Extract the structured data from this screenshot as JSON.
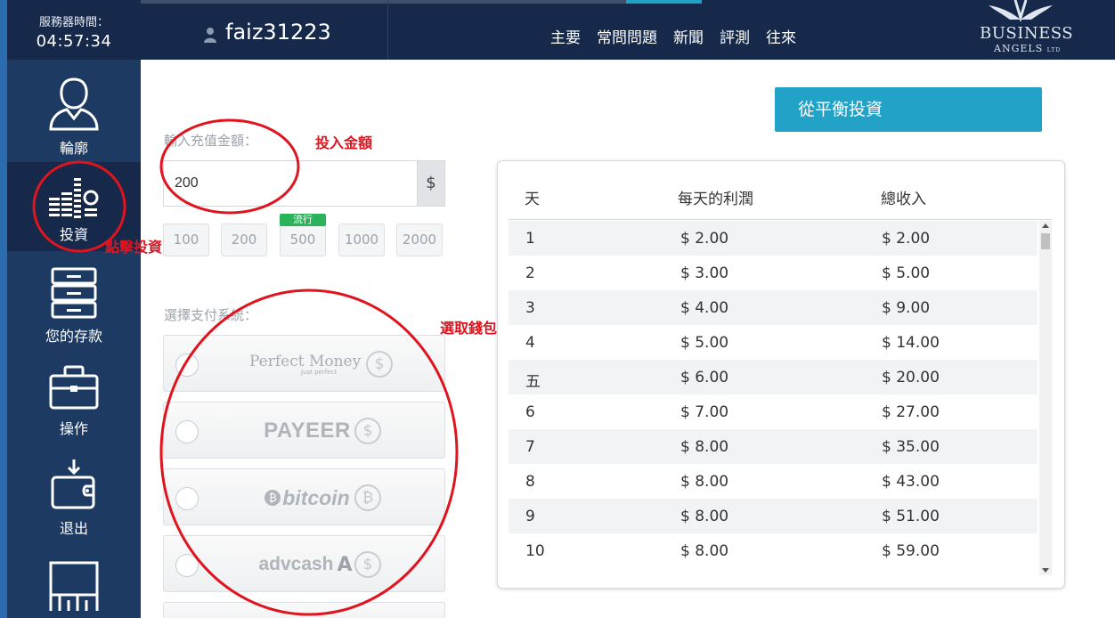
{
  "sidebar": {
    "server_time_label": "服務器時間：",
    "server_time": "04:57:34",
    "items": [
      {
        "label": "輪廓"
      },
      {
        "label": "投資"
      },
      {
        "label": "您的存款"
      },
      {
        "label": "操作"
      },
      {
        "label": "退出"
      }
    ]
  },
  "header": {
    "username": "faiz31223",
    "nav": [
      "主要",
      "常問問題",
      "新聞",
      "評測",
      "往來"
    ],
    "logo_line1": "BUSINESS",
    "logo_line2": "ANGELS",
    "logo_suffix": "LTD"
  },
  "form": {
    "amount_label": "輸入充值金額：",
    "amount_value": "200",
    "currency_symbol": "$",
    "quick_amounts": [
      "100",
      "200",
      "500",
      "1000",
      "2000"
    ],
    "popular_badge": "流行",
    "payment_label": "選擇支付系統：",
    "payment_methods": [
      {
        "name": "Perfect Money",
        "tagline": "Just perfect",
        "coin": "$"
      },
      {
        "name": "PAYEER",
        "coin": "$"
      },
      {
        "name": "bitcoin",
        "coin": "₿"
      },
      {
        "name": "advcash",
        "coin": "$"
      }
    ],
    "invest_button": "從平衡投資"
  },
  "profit_table": {
    "headers": [
      "天",
      "每天的利潤",
      "總收入"
    ],
    "rows": [
      [
        "1",
        "$ 2.00",
        "$ 2.00"
      ],
      [
        "2",
        "$ 3.00",
        "$ 5.00"
      ],
      [
        "3",
        "$ 4.00",
        "$ 9.00"
      ],
      [
        "4",
        "$ 5.00",
        "$ 14.00"
      ],
      [
        "五",
        "$ 6.00",
        "$ 20.00"
      ],
      [
        "6",
        "$ 7.00",
        "$ 27.00"
      ],
      [
        "7",
        "$ 8.00",
        "$ 35.00"
      ],
      [
        "8",
        "$ 8.00",
        "$ 43.00"
      ],
      [
        "9",
        "$ 8.00",
        "$ 51.00"
      ],
      [
        "10",
        "$ 8.00",
        "$ 59.00"
      ]
    ]
  },
  "annotations": {
    "amount_note": "投入金額",
    "invest_note": "點擊投資",
    "wallet_note": "選取錢包"
  },
  "colors": {
    "sidebar_bg": "#1d3a63",
    "header_bg": "#16294a",
    "accent": "#21a2c6",
    "annotation_red": "#e0141e",
    "badge_green": "#2bb35a"
  }
}
